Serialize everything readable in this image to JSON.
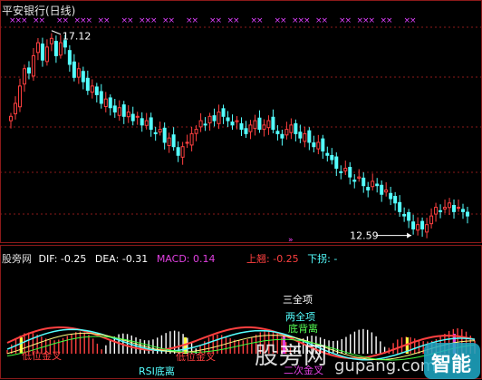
{
  "title": "平安银行(日线)",
  "colors": {
    "background": "#000000",
    "up": "#ff4040",
    "down": "#54ffff",
    "grid": "#8b1a1a",
    "marker": "#e040ff",
    "white": "#ffffff",
    "yellow": "#ffff40",
    "green": "#40ff40",
    "magenta": "#e040e0",
    "dea_line": "#ffff80"
  },
  "price_panel": {
    "high_label": "17.12",
    "low_label": "12.59"
  },
  "indicator_bar": {
    "source": "股旁网",
    "dif_label": "DIF:",
    "dif_value": "-0.25",
    "dea_label": "DEA:",
    "dea_value": "-0.31",
    "macd_label": "MACD:",
    "macd_value": "0.14",
    "up_label": "上翘:",
    "up_value": "-0.25",
    "down_label": "下拐:",
    "down_value": "-"
  },
  "signals": {
    "low_golden_cross": "低位金叉",
    "rsi_divergence": "RSI底离",
    "low_golden_cross_2": "低位金叉",
    "three_top": "三全项",
    "two_top": "两全项",
    "bottom_divergence": "底背离",
    "second_golden_cross": "二次金叉"
  },
  "watermark": {
    "text_cn": "股旁网",
    "text_url": "gupang.com",
    "logo_text": "智能"
  },
  "chart_data": {
    "type": "candlestick",
    "title": "平安银行(日线)",
    "annotations": [
      {
        "label": "17.12",
        "value": 17.12,
        "kind": "high"
      },
      {
        "label": "12.59",
        "value": 12.59,
        "kind": "low"
      }
    ],
    "close": [
      15.2,
      15.5,
      15.9,
      16.3,
      16.2,
      16.6,
      16.9,
      16.5,
      16.8,
      17.0,
      16.6,
      16.9,
      16.8,
      16.4,
      16.1,
      16.3,
      16.0,
      15.8,
      15.9,
      15.7,
      15.5,
      15.6,
      15.4,
      15.3,
      15.4,
      15.2,
      15.3,
      15.1,
      15.2,
      15.0,
      15.1,
      14.9,
      14.8,
      14.9,
      14.6,
      14.7,
      14.5,
      14.3,
      14.5,
      14.6,
      14.8,
      14.9,
      15.1,
      15.0,
      15.2,
      15.1,
      15.3,
      15.2,
      15.1,
      15.0,
      15.1,
      14.9,
      14.8,
      15.0,
      15.1,
      14.9,
      15.0,
      15.1,
      14.9,
      14.8,
      14.7,
      14.9,
      15.0,
      14.8,
      14.7,
      14.8,
      14.6,
      14.5,
      14.6,
      14.4,
      14.3,
      14.2,
      14.0,
      13.9,
      14.0,
      13.8,
      13.7,
      13.8,
      13.6,
      13.5,
      13.7,
      13.6,
      13.4,
      13.5,
      13.3,
      13.2,
      13.0,
      12.9,
      12.8,
      12.6,
      12.7,
      12.6,
      12.7,
      12.9,
      13.1,
      13.0,
      13.1,
      13.2,
      13.0,
      13.1,
      13.0,
      12.9
    ],
    "macd_summary": {
      "DIF": -0.25,
      "DEA": -0.31,
      "MACD": 0.14
    }
  }
}
